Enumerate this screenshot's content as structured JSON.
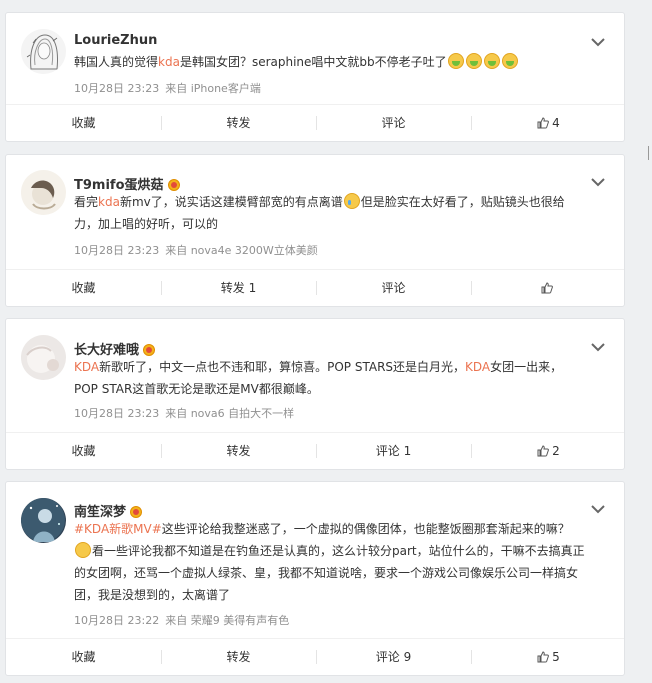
{
  "comments": [
    {
      "username": "LourieZhun",
      "has_badge": false,
      "text_parts": [
        {
          "t": "韩国人真的觉得",
          "hl": false
        },
        {
          "t": "kda",
          "hl": true
        },
        {
          "t": "是韩国女团？seraphine唱中文就bb不停老子吐了",
          "hl": false
        }
      ],
      "emoji": [
        "vomit-emoji",
        "vomit-emoji",
        "vomit-emoji",
        "vomit-emoji"
      ],
      "time": "10月28日 23:23",
      "source": "来自 iPhone客户端",
      "actions": {
        "collect": "收藏",
        "repost": "转发",
        "comment": "评论",
        "like": "4"
      }
    },
    {
      "username": "T9mifo蛋烘菇",
      "has_badge": true,
      "line1_parts": [
        {
          "t": "看完",
          "hl": false
        },
        {
          "t": "kda",
          "hl": true
        },
        {
          "t": "新mv了，说实话这建模臂部宽的有点离谱",
          "hl": false
        }
      ],
      "line1_tail": "但是脸实在太好看了，贴贴镜头也很给",
      "line2": "力，加上唱的好听，可以的",
      "time": "10月28日 23:23",
      "source": "来自 nova4e 3200W立体美颜",
      "actions": {
        "collect": "收藏",
        "repost": "转发 1",
        "comment": "评论",
        "like": ""
      }
    },
    {
      "username": "长大好难哦",
      "has_badge": true,
      "line1_parts": [
        {
          "t": "KDA",
          "hl": true
        },
        {
          "t": "新歌听了，中文一点也不违和耶，算惊喜。POP STARS还是白月光，",
          "hl": false
        },
        {
          "t": "KDA",
          "hl": true
        },
        {
          "t": "女团一出来，",
          "hl": false
        }
      ],
      "line2": "POP STAR这首歌无论是歌还是MV都很巅峰。",
      "time": "10月28日 23:23",
      "source": "来自 nova6 自拍大不一样",
      "actions": {
        "collect": "收藏",
        "repost": "转发",
        "comment": "评论 1",
        "like": "2"
      }
    },
    {
      "username": "南笙深梦",
      "has_badge": true,
      "topic": "#KDA新歌MV#",
      "line1_rest": "这些评论给我整迷惑了，一个虚拟的偶像团体，也能整饭圈那套渐起来的嘛？",
      "line2": "看一些评论我都不知道是在钓鱼还是认真的，这么计较分part，站位什么的，干嘛不去搞真正",
      "line3": "的女团啊，还骂一个虚拟人绿茶、皇，我都不知道说啥，要求一个游戏公司像娱乐公司一样搞女",
      "line4": "团，我是没想到的，太离谱了",
      "time": "10月28日 23:22",
      "source": "来自 荣耀9 美得有声有色",
      "actions": {
        "collect": "收藏",
        "repost": "转发",
        "comment": "评论 9",
        "like": "5"
      }
    }
  ]
}
